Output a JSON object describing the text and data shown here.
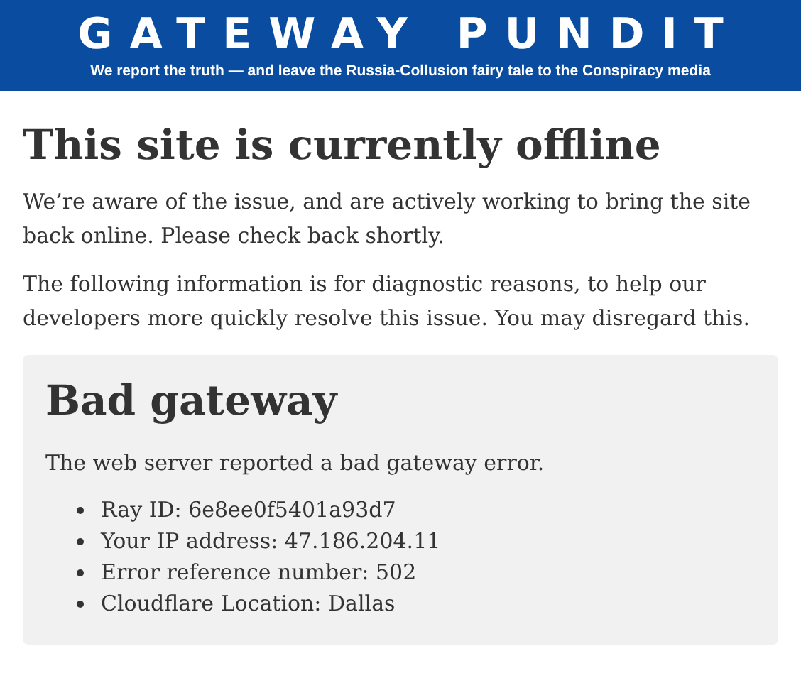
{
  "banner": {
    "title": "GATEWAY PUNDIT",
    "tagline": "We report the truth — and leave the Russia-Collusion fairy tale to the Conspiracy media"
  },
  "heading": "This site is currently offline",
  "paragraphs": [
    "We’re aware of the issue, and are actively working to bring the site back online. Please check back shortly.",
    "The following information is for diagnostic reasons, to help our developers more quickly resolve this issue. You may disregard this."
  ],
  "error_box": {
    "title": "Bad gateway",
    "message": "The web server reported a bad gateway error.",
    "details": [
      "Ray ID: 6e8ee0f5401a93d7",
      "Your IP address: 47.186.204.11",
      "Error reference number: 502",
      "Cloudflare Location: Dallas"
    ]
  }
}
